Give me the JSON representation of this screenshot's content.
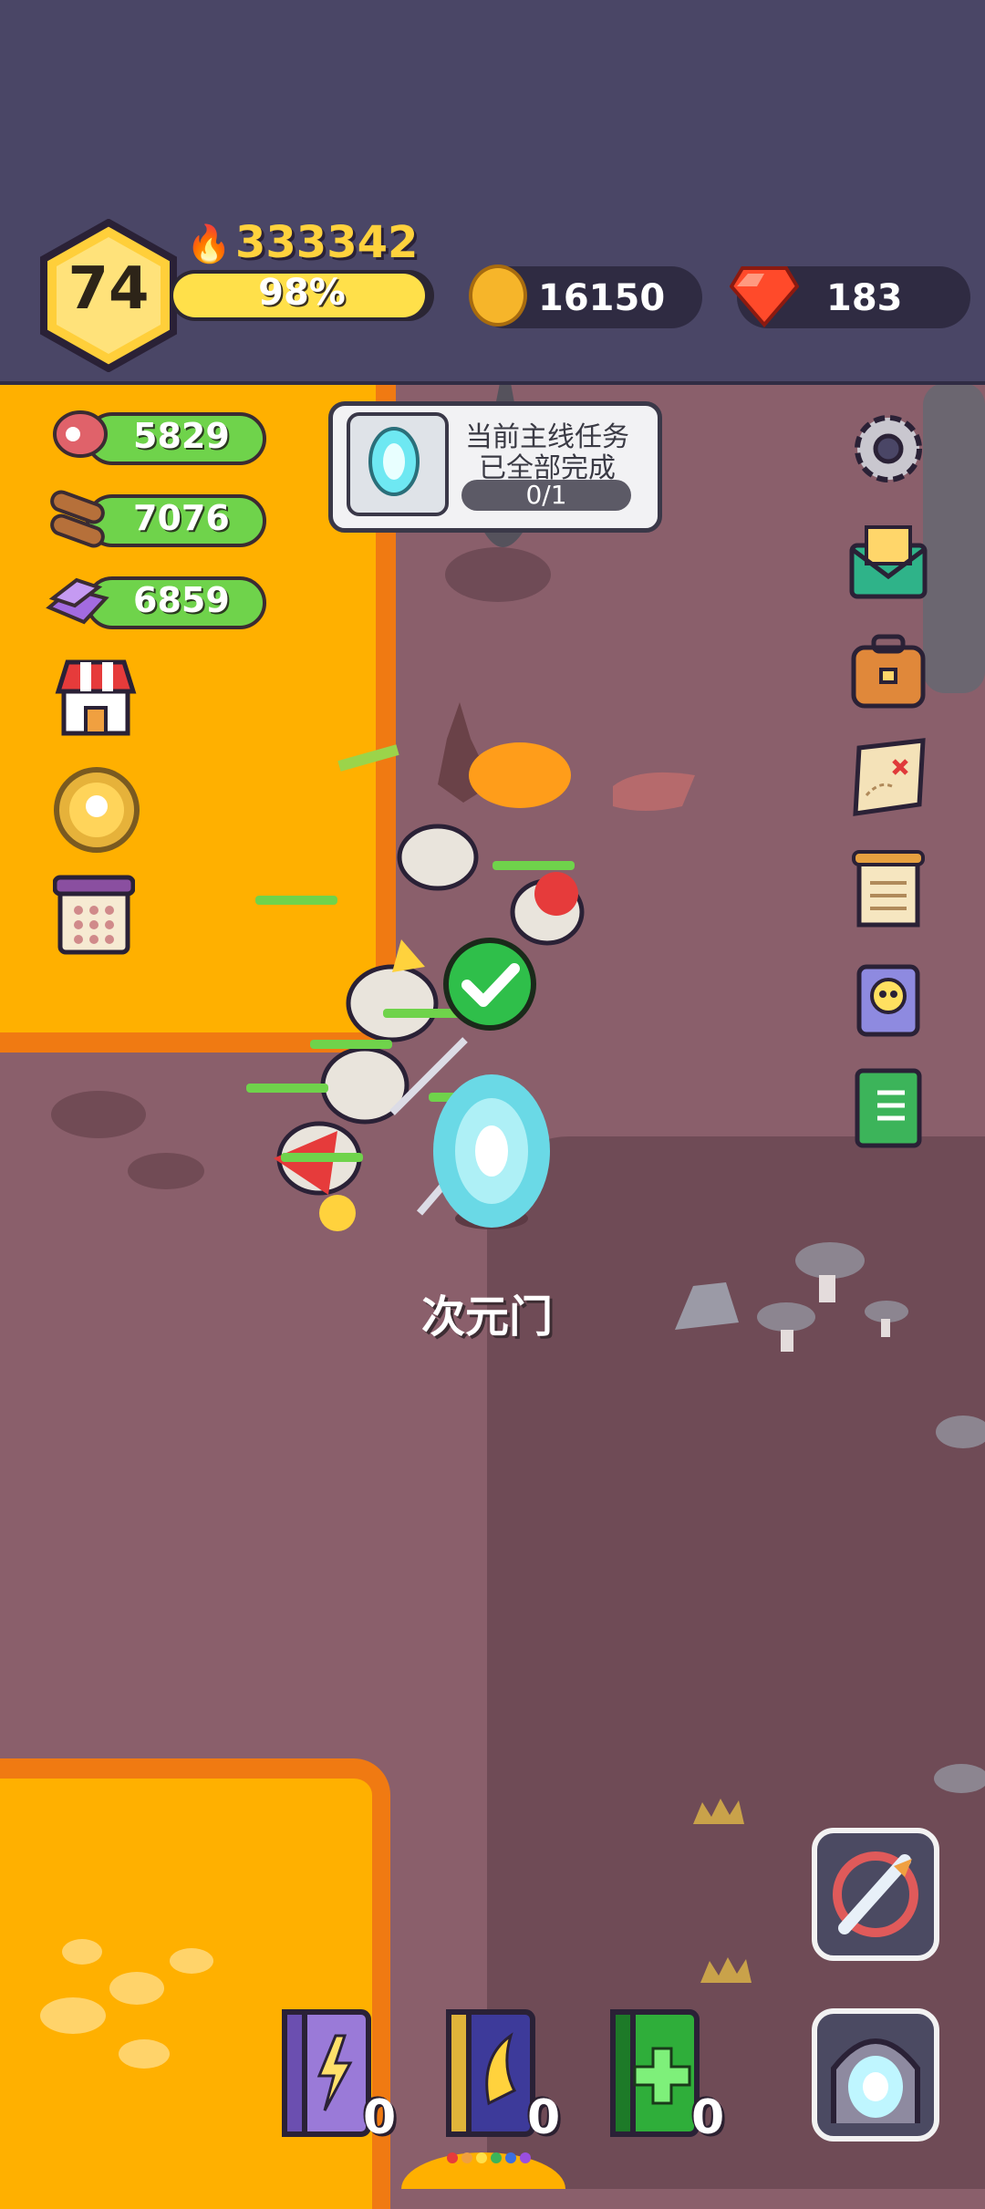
{
  "player": {
    "level": "74",
    "power": "333342",
    "xp_text": "98%",
    "xp_fraction": 0.98
  },
  "currency": {
    "coins": "16150",
    "gems": "183"
  },
  "resources": {
    "meat": "5829",
    "wood": "7076",
    "ore": "6859"
  },
  "quest": {
    "line1": "当前主线任务",
    "line2": "已全部完成",
    "progress": "0/1"
  },
  "map": {
    "portal_label": "次元门"
  },
  "skills": {
    "lightning_count": "0",
    "wing_count": "0",
    "heal_count": "0"
  },
  "colors": {
    "topbar": "#4a4666",
    "lava": "#ffb000",
    "ground": "#8a5f6b",
    "accent_green": "#6fd34b",
    "gold": "#ffd23d"
  },
  "icons": [
    "fire-icon",
    "coin-icon",
    "gem-icon",
    "meat-icon",
    "wood-icon",
    "ore-icon",
    "shop-icon",
    "medal-icon",
    "calendar-icon",
    "settings-icon",
    "mail-icon",
    "bag-icon",
    "map-icon",
    "notes-icon",
    "skull-card-icon",
    "book-icon",
    "portal-icon",
    "check-icon",
    "lightning-book-icon",
    "wing-book-icon",
    "heal-book-icon",
    "fight-icon",
    "gate-icon"
  ]
}
